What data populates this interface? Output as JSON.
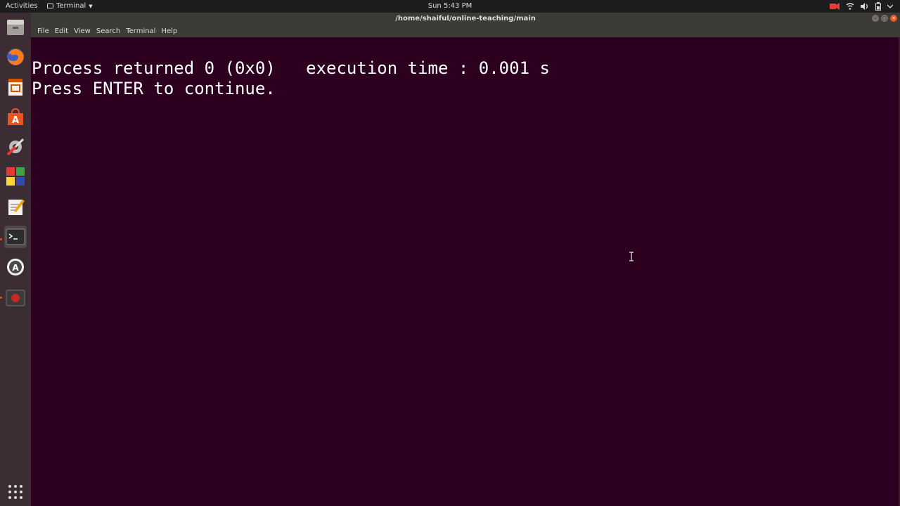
{
  "topbar": {
    "activities": "Activities",
    "app_name": "Terminal",
    "clock": "Sun  5:43 PM",
    "tray_icons": [
      "camera-icon",
      "wifi-icon",
      "volume-icon",
      "battery-icon",
      "chevron-down-icon"
    ]
  },
  "dock": {
    "items": [
      "files-icon",
      "firefox-icon",
      "impress-icon",
      "software-store-icon",
      "settings-icon",
      "apps-icon",
      "text-editor-icon",
      "terminal-icon",
      "software-updater-icon",
      "recorder-icon"
    ],
    "show_apps": "show-applications-icon"
  },
  "window": {
    "title": "/home/shaiful/online-teaching/main",
    "menu": [
      "File",
      "Edit",
      "View",
      "Search",
      "Terminal",
      "Help"
    ]
  },
  "terminal": {
    "line1": "Process returned 0 (0x0)   execution time : 0.001 s",
    "line2": "Press ENTER to continue."
  },
  "colors": {
    "terminal_bg": "#2c001e",
    "accent": "#e95420"
  }
}
